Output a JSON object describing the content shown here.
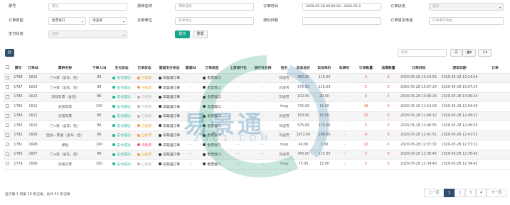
{
  "filters": {
    "ticket_no": {
      "label": "票号",
      "placeholder": "票号"
    },
    "ticket_name": {
      "label": "票种名称",
      "placeholder": "票种名称"
    },
    "order_time": {
      "label": "订单时间",
      "value": "2020-05-28 00:00:00 - 2020-05-2"
    },
    "order_status": {
      "label": "订单状态",
      "placeholder": "选择"
    },
    "order_type": {
      "label": "订单类型",
      "value": "售票窗口",
      "value2": "请选择"
    },
    "settle_unit": {
      "label": "买单单位",
      "placeholder": "买单单位"
    },
    "visit_date": {
      "label": "游玩日期",
      "placeholder": ""
    },
    "order_phone": {
      "label": "订单填写电话",
      "placeholder": "订单填写电话"
    },
    "pay_status": {
      "label": "支付状态",
      "placeholder": "选择"
    },
    "submit_label": "提交",
    "reset_label": "重置"
  },
  "toolbar": {
    "search_placeholder": "搜索",
    "list_icon": "list-icon",
    "columns_icon": "columns-icon",
    "export_icon": "export-icon"
  },
  "table": {
    "headers": [
      "",
      "票号",
      "订单id",
      "票种名称",
      "下单人id",
      "支付状态",
      "订单状态",
      "渠道支付状态",
      "渠道id",
      "订单类型",
      "上游旅行社",
      "旅行社名称",
      "姓名",
      "实收总价",
      "实收单价",
      "车牌号",
      "订单数量",
      "退票数量",
      "订单时间",
      "游玩日期",
      "订单"
    ],
    "rows": [
      [
        "",
        "1788",
        "1615",
        "门+索（含车、险）",
        "86",
        "支付成功",
        "已核票",
        "非渠道订单",
        "-",
        "售票窗口",
        "-",
        "-",
        "刘凌芳",
        "460.00",
        "115.00",
        "-",
        "4",
        "0",
        "2020-05-28 13:24:54",
        "2020-05-28 13:24:54",
        ""
      ],
      [
        "",
        "1787",
        "1614",
        "门+索（含车、险）",
        "86",
        "支付成功",
        "已核票",
        "非渠道订单",
        "-",
        "售票窗口",
        "-",
        "-",
        "刘凌芳",
        "575.00",
        "115.00",
        "-",
        "5",
        "0",
        "2020-05-28 13:07:24",
        "2020-05-28 13:07:24",
        ""
      ],
      [
        "",
        "1786",
        "1613",
        "双程车票（含险）",
        "86",
        "支付成功",
        "已使用",
        "非渠道订单",
        "-",
        "售票窗口",
        "-",
        "-",
        "刘凌芳",
        "102.00",
        "20.00",
        "-",
        "6",
        "0",
        "2020-05-28 13:06:24",
        "2020-05-28 13:06:24",
        ""
      ],
      [
        "",
        "1785",
        "1612",
        "双程车票",
        "100",
        "支付成功",
        "已使用",
        "非渠道订单",
        "-",
        "售票窗口",
        "-",
        "-",
        "fang",
        "735.00",
        "15.00",
        "-",
        "49",
        "0",
        "2020-05-28 12:54:09",
        "2020-05-28 12:54:09",
        ""
      ],
      [
        "",
        "1784",
        "1611",
        "双程车票",
        "86",
        "支付成功",
        "已使用",
        "非渠道订单",
        "-",
        "售票窗口",
        "-",
        "-",
        "刘凌芳",
        "150.00",
        "15.00",
        "-",
        "10",
        "0",
        "2020-05-28 12:49:12",
        "2020-05-28 12:49:12",
        ""
      ],
      [
        "",
        "1783",
        "1610",
        "门+索（含车、险）",
        "86",
        "支付成功",
        "已核票",
        "非渠道订单",
        "-",
        "售票窗口",
        "-",
        "-",
        "刘凌芳",
        "575.00",
        "115.00",
        "-",
        "5",
        "0",
        "2020-05-28 12:46:55",
        "2020-05-28 12:46:55",
        ""
      ],
      [
        "",
        "1782",
        "1609",
        "西省一票通（含车、险）",
        "86",
        "支付成功",
        "已核票",
        "非渠道订单",
        "-",
        "售票窗口",
        "-",
        "-",
        "刘凌芳",
        "1072.00",
        "268.00",
        "-",
        "4",
        "0",
        "2020-05-28 12:41:51",
        "2020-05-28 12:41:51",
        ""
      ],
      [
        "",
        "1781",
        "1608",
        "保险",
        "100",
        "支付成功",
        "待检票",
        "非渠道订单",
        "-",
        "售票窗口",
        "-",
        "-",
        "fang",
        "40.00",
        "2.00",
        "-",
        "20",
        "0",
        "2020-05-28 12:37:32",
        "2020-05-28 12:37:32",
        ""
      ],
      [
        "",
        "1780",
        "1607",
        "门+索（含车、险）",
        "86",
        "支付成功",
        "已核票",
        "非渠道订单",
        "-",
        "售票窗口",
        "-",
        "-",
        "刘凌芳",
        "345.00",
        "115.00",
        "-",
        "3",
        "0",
        "2020-05-28 12:36:45",
        "2020-05-28 12:36:45",
        ""
      ],
      [
        "",
        "1779",
        "1606",
        "双程车票",
        "100",
        "支付成功",
        "已使用",
        "非渠道订单",
        "-",
        "售票窗口",
        "-",
        "-",
        "fang",
        "75.00",
        "15.00",
        "-",
        "5",
        "0",
        "2020-05-28 12:34:43",
        "2020-05-28 12:34:43",
        ""
      ]
    ],
    "status_colors": {
      "支付成功": "#1ab394",
      "已核票": "#f0a23a",
      "已使用": "#b5b5b5",
      "待检票": "#ed5565",
      "非渠道订单": "#333333",
      "售票窗口": "#333333"
    }
  },
  "footer": {
    "summary": "显示第 1 到第 10 条记录，总共 32 条记录",
    "pages": [
      "上一页",
      "1",
      "2",
      "3",
      "4",
      "下一页"
    ],
    "active_page": "1"
  },
  "watermark": {
    "title": "易景通",
    "subtitle": "2301.COM"
  }
}
